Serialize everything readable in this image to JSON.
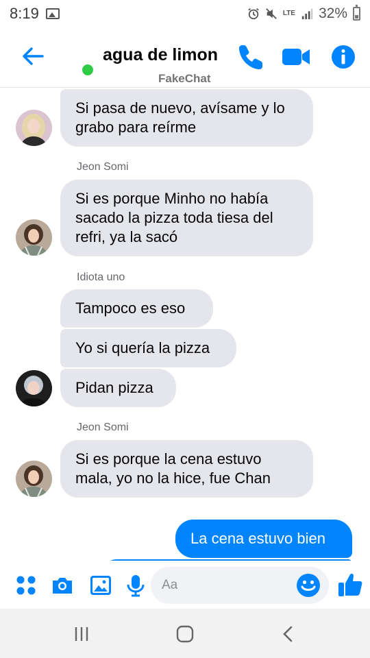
{
  "status": {
    "time": "8:19",
    "network": "LTE",
    "battery": "32%"
  },
  "header": {
    "name": "agua de limon",
    "subtitle": "FakeChat"
  },
  "messages": [
    {
      "text": "Si pasa de nuevo, avísame y lo grabo para reírme"
    },
    {
      "sender": "Jeon Somi",
      "text": "Si es porque Minho no había sacado la pizza toda tiesa del refri, ya la sacó"
    },
    {
      "sender": "Idiota uno",
      "text": "Tampoco es eso"
    },
    {
      "text": "Yo si quería la pizza"
    },
    {
      "text": "Pidan pizza"
    },
    {
      "sender": "Jeon Somi",
      "text": "Si es porque la cena estuvo mala, yo no la hice, fue Chan"
    },
    {
      "text": "La cena estuvo bien"
    }
  ],
  "composer": {
    "placeholder": "Aa"
  },
  "colors": {
    "accent": "#0084ff",
    "bubble_gray": "#e4e6eb",
    "online": "#31cc46"
  }
}
